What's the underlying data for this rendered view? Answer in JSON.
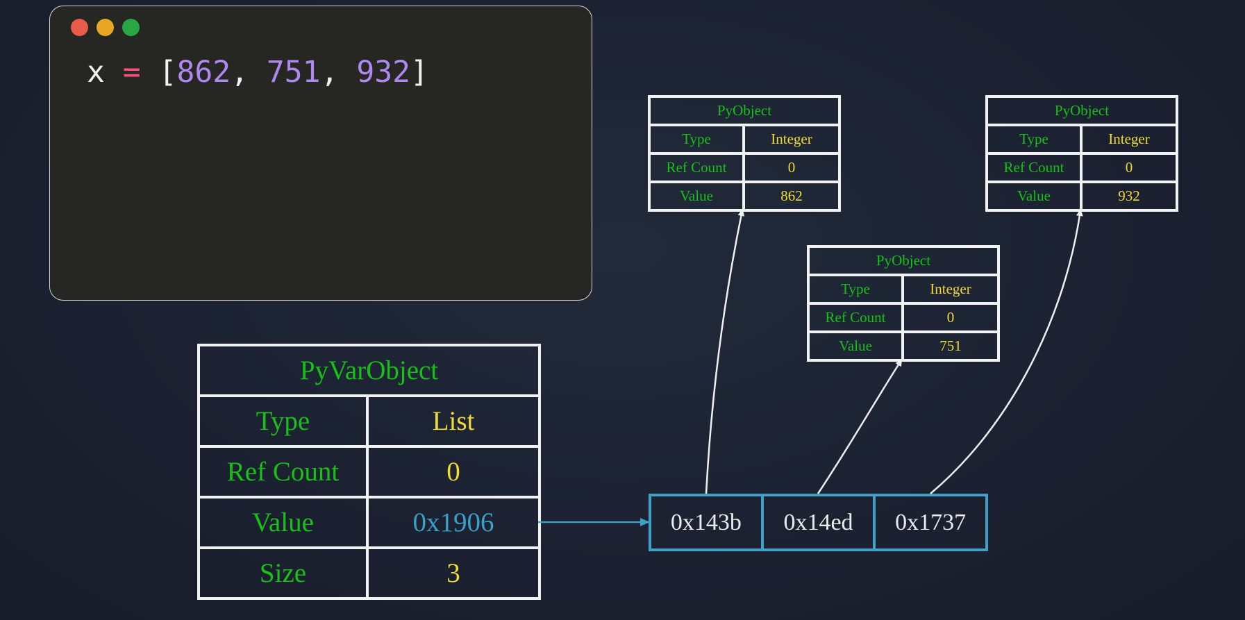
{
  "code": {
    "var": "x",
    "op": "=",
    "open": "[",
    "items": [
      "862",
      "751",
      "932"
    ],
    "sep": ", ",
    "close": "]"
  },
  "colors": {
    "label": "#18c018",
    "value": "#f2dc32",
    "address": "#3aa0c8",
    "operator": "#ff4f7e",
    "number": "#b089f0"
  },
  "pyvarobject": {
    "title": "PyVarObject",
    "rows": [
      {
        "label": "Type",
        "value": "List"
      },
      {
        "label": "Ref Count",
        "value": "0"
      },
      {
        "label": "Value",
        "value": "0x1906"
      },
      {
        "label": "Size",
        "value": "3"
      }
    ]
  },
  "pointer_array": [
    "0x143b",
    "0x14ed",
    "0x1737"
  ],
  "pyobjects": [
    {
      "title": "PyObject",
      "rows": [
        {
          "label": "Type",
          "value": "Integer"
        },
        {
          "label": "Ref Count",
          "value": "0"
        },
        {
          "label": "Value",
          "value": "862"
        }
      ]
    },
    {
      "title": "PyObject",
      "rows": [
        {
          "label": "Type",
          "value": "Integer"
        },
        {
          "label": "Ref Count",
          "value": "0"
        },
        {
          "label": "Value",
          "value": "751"
        }
      ]
    },
    {
      "title": "PyObject",
      "rows": [
        {
          "label": "Type",
          "value": "Integer"
        },
        {
          "label": "Ref Count",
          "value": "0"
        },
        {
          "label": "Value",
          "value": "932"
        }
      ]
    }
  ]
}
